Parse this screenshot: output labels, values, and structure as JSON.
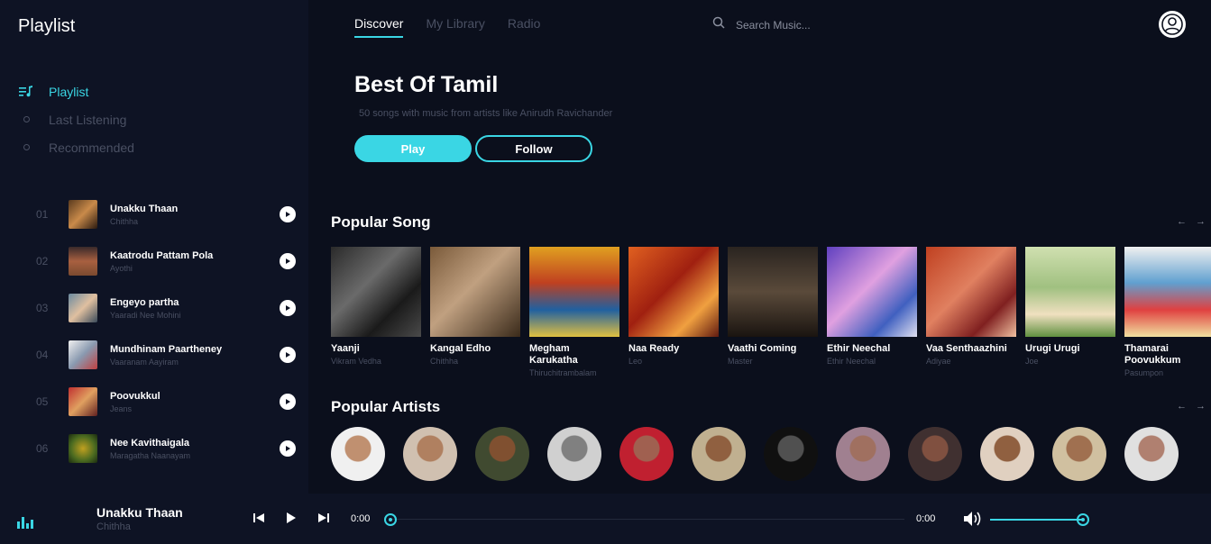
{
  "sidebar": {
    "title": "Playlist",
    "nav": [
      {
        "label": "Playlist",
        "active": true
      },
      {
        "label": "Last Listening",
        "active": false
      },
      {
        "label": "Recommended",
        "active": false
      }
    ],
    "tracks": [
      {
        "num": "01",
        "title": "Unakku Thaan",
        "sub": "Chithha"
      },
      {
        "num": "02",
        "title": "Kaatrodu Pattam Pola",
        "sub": "Ayothi"
      },
      {
        "num": "03",
        "title": "Engeyo partha",
        "sub": "Yaaradi Nee Mohini"
      },
      {
        "num": "04",
        "title": "Mundhinam Paartheney",
        "sub": "Vaaranam Aayiram"
      },
      {
        "num": "05",
        "title": "Poovukkul",
        "sub": "Jeans"
      },
      {
        "num": "06",
        "title": "Nee Kavithaigala",
        "sub": "Maragatha Naanayam"
      }
    ]
  },
  "header": {
    "tabs": [
      {
        "label": "Discover",
        "active": true
      },
      {
        "label": "My Library",
        "active": false
      },
      {
        "label": "Radio",
        "active": false
      }
    ],
    "search_placeholder": "Search Music..."
  },
  "hero": {
    "title": "Best Of Tamil",
    "subtitle": "50 songs with music from artists like Anirudh Ravichander",
    "play_label": "Play",
    "follow_label": "Follow"
  },
  "popular_songs": {
    "title": "Popular Song",
    "items": [
      {
        "title": "Yaanji",
        "sub": "Vikram Vedha"
      },
      {
        "title": "Kangal Edho",
        "sub": "Chithha"
      },
      {
        "title": "Megham Karukatha",
        "sub": "Thiruchitrambalam"
      },
      {
        "title": "Naa Ready",
        "sub": "Leo"
      },
      {
        "title": "Vaathi Coming",
        "sub": "Master"
      },
      {
        "title": "Ethir Neechal",
        "sub": "Ethir Neechal"
      },
      {
        "title": "Vaa Senthaazhini",
        "sub": "Adiyae"
      },
      {
        "title": "Urugi Urugi",
        "sub": "Joe"
      },
      {
        "title": "Thamarai Poovukkum",
        "sub": "Pasumpon"
      }
    ]
  },
  "popular_artists": {
    "title": "Popular Artists",
    "count": 12
  },
  "player": {
    "title": "Unakku Thaan",
    "artist": "Chithha",
    "current_time": "0:00",
    "duration": "0:00",
    "progress": 0,
    "volume": 1.0
  },
  "colors": {
    "accent": "#3ad6e4",
    "background": "#0b0f1c",
    "sidebar": "#0e1324",
    "muted": "#4a5063"
  },
  "icons": {
    "arrow_left": "←",
    "arrow_right": "→"
  }
}
